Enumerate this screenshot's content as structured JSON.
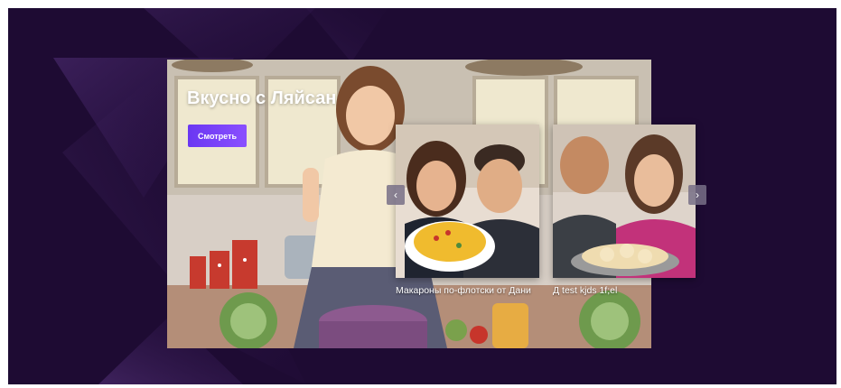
{
  "hero": {
    "title": "Вкусно с Ляйсан",
    "watch_button_label": "Смотреть"
  },
  "carousel": {
    "prev_icon": "‹",
    "next_icon": "›",
    "cards": [
      {
        "caption": "Макароны по-флотски от Дани"
      },
      {
        "caption": "Д test kjds 1f;el"
      }
    ]
  },
  "colors": {
    "background": "#1e0b33",
    "accent_button": "#6a37f2",
    "text": "#ffffff"
  }
}
